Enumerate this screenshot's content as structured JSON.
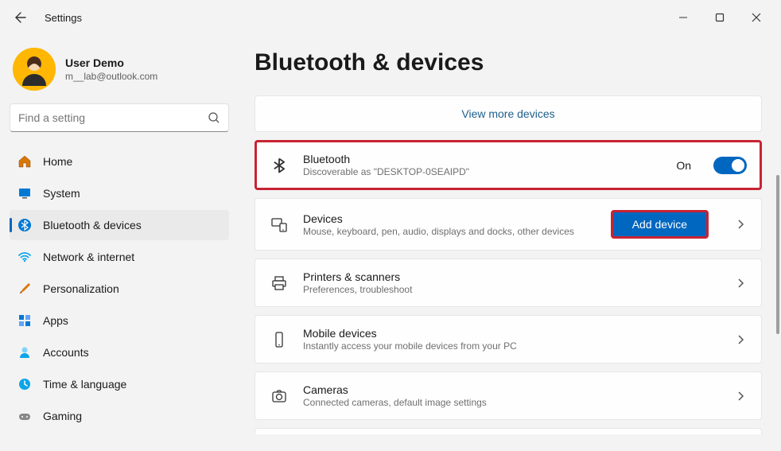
{
  "window": {
    "title": "Settings"
  },
  "profile": {
    "name": "User Demo",
    "email": "m__lab@outlook.com"
  },
  "search": {
    "placeholder": "Find a setting"
  },
  "nav": {
    "items": [
      {
        "id": "home",
        "label": "Home"
      },
      {
        "id": "system",
        "label": "System"
      },
      {
        "id": "bluetooth",
        "label": "Bluetooth & devices"
      },
      {
        "id": "network",
        "label": "Network & internet"
      },
      {
        "id": "personalization",
        "label": "Personalization"
      },
      {
        "id": "apps",
        "label": "Apps"
      },
      {
        "id": "accounts",
        "label": "Accounts"
      },
      {
        "id": "time",
        "label": "Time & language"
      },
      {
        "id": "gaming",
        "label": "Gaming"
      }
    ]
  },
  "page": {
    "title": "Bluetooth & devices",
    "view_more": "View more devices",
    "bluetooth": {
      "title": "Bluetooth",
      "subtitle": "Discoverable as \"DESKTOP-0SEAIPD\"",
      "state_label": "On"
    },
    "devices": {
      "title": "Devices",
      "subtitle": "Mouse, keyboard, pen, audio, displays and docks, other devices",
      "button": "Add device"
    },
    "printers": {
      "title": "Printers & scanners",
      "subtitle": "Preferences, troubleshoot"
    },
    "mobile": {
      "title": "Mobile devices",
      "subtitle": "Instantly access your mobile devices from your PC"
    },
    "cameras": {
      "title": "Cameras",
      "subtitle": "Connected cameras, default image settings"
    }
  }
}
